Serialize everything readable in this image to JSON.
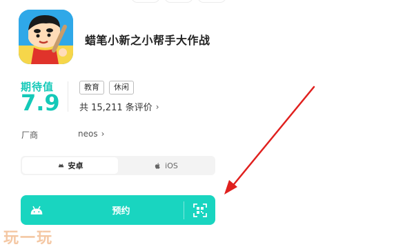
{
  "app": {
    "title": "蜡笔小新之小帮手大作战",
    "icon": "crayon-shinchan-app-icon"
  },
  "rating": {
    "label": "期待值",
    "value": "7.9"
  },
  "tags": [
    "教育",
    "休闲"
  ],
  "reviews": {
    "text": "共 15,211 条评价",
    "chevron": "›"
  },
  "vendor": {
    "label": "厂商",
    "value": "neos",
    "chevron": "›"
  },
  "platforms": {
    "android": "安卓",
    "ios": "iOS",
    "selected": "安卓"
  },
  "reserve": {
    "label": "预约"
  },
  "watermark": "玩一玩",
  "colors": {
    "accent": "#19d5c0",
    "rating": "#14c9b8",
    "arrow": "#e0201e",
    "watermark": "#f3c19a"
  }
}
